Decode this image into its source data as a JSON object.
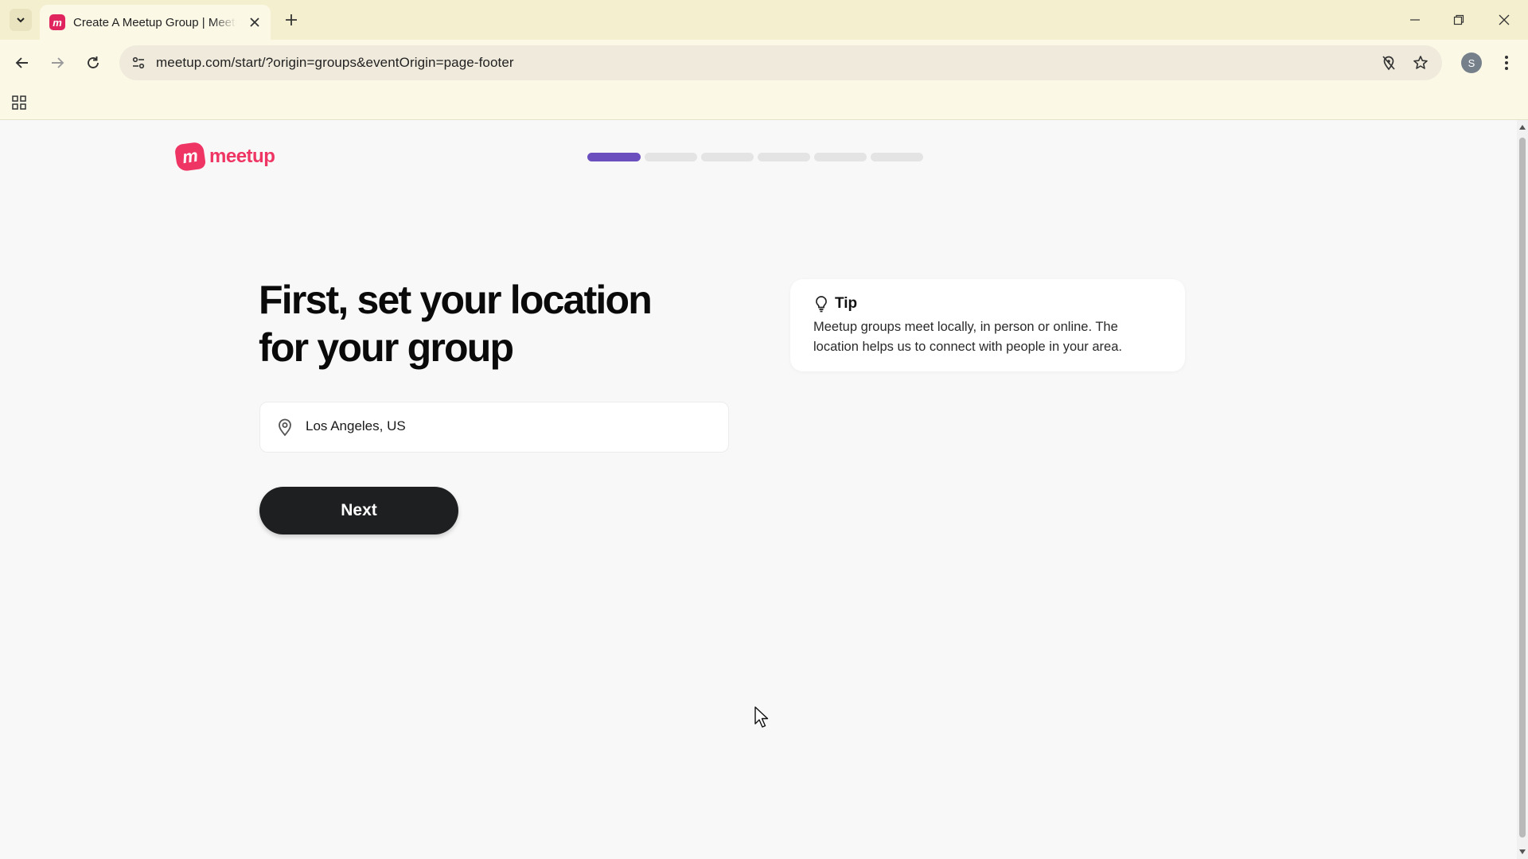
{
  "browser": {
    "tab": {
      "title": "Create A Meetup Group | Meetup",
      "favicon": "m"
    },
    "address_bar": {
      "url": "meetup.com/start/?origin=groups&eventOrigin=page-footer"
    },
    "profile_initial": "S"
  },
  "page": {
    "logo": {
      "mark": "m",
      "text": "meetup",
      "color": "#ef3563"
    },
    "progress": {
      "steps": 6,
      "current": 1,
      "active_color": "#6b4fbf"
    },
    "headline": "First, set your location for your group",
    "location": {
      "value": "Los Angeles, US"
    },
    "next_button": {
      "label": "Next"
    },
    "tip": {
      "title": "Tip",
      "text": "Meetup groups meet locally, in person or online. The location helps us to connect with people in your area."
    }
  },
  "colors": {
    "tabbar": "#f4efcf",
    "toolbar": "#fbf8e6",
    "button": "#1e1f21"
  }
}
